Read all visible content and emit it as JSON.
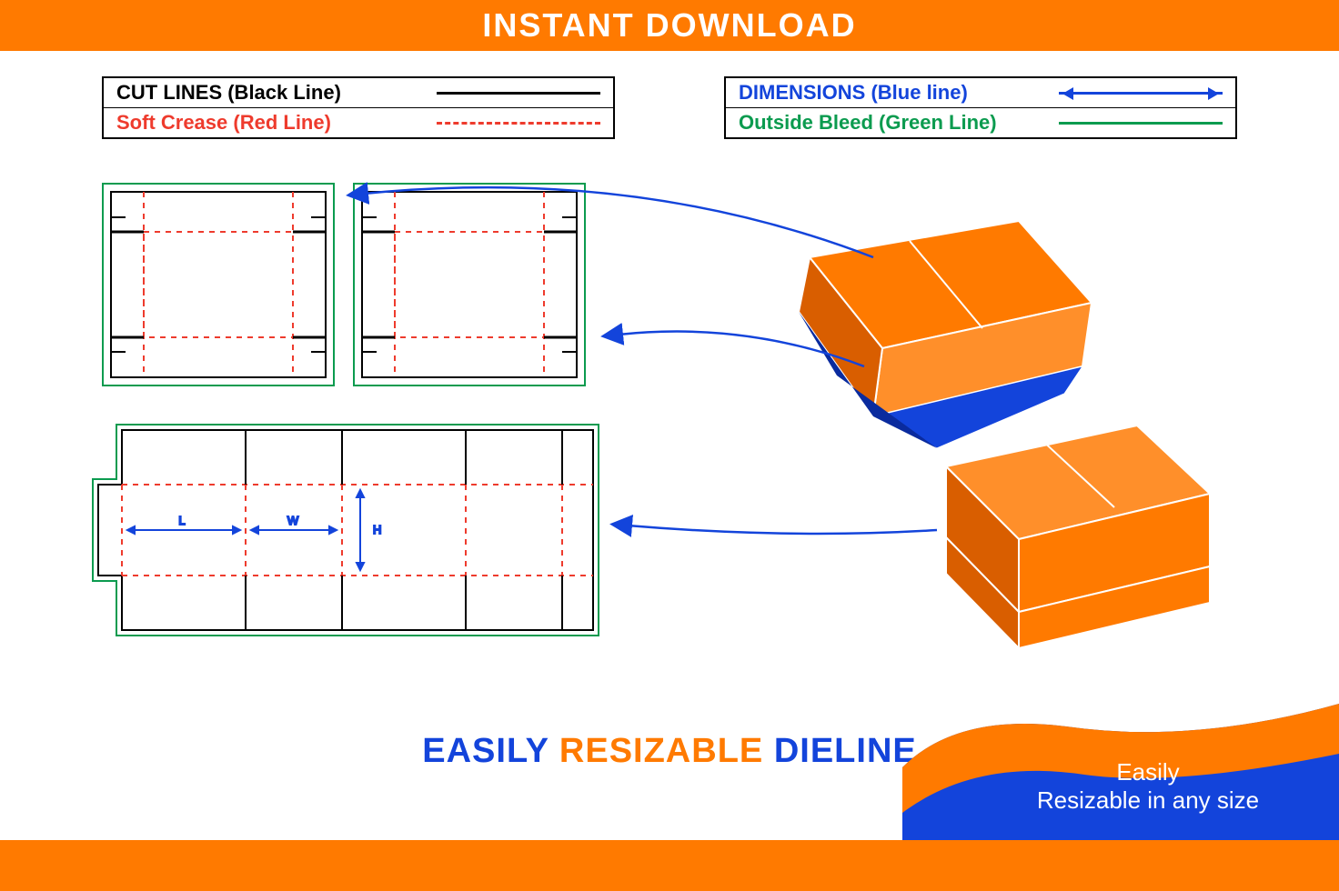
{
  "header": {
    "title": "INSTANT DOWNLOAD"
  },
  "legend": {
    "left": [
      {
        "label": "CUT LINES (Black Line)",
        "color": "#000000",
        "style": "solid"
      },
      {
        "label": "Soft Crease (Red Line)",
        "color": "#ee3b2d",
        "style": "dashed"
      }
    ],
    "right": [
      {
        "label": "DIMENSIONS (Blue line)",
        "color": "#1344db",
        "style": "arrow"
      },
      {
        "label": "Outside Bleed (Green Line)",
        "color": "#0b9b4f",
        "style": "solid"
      }
    ]
  },
  "dimensions": {
    "L": "L",
    "W": "W",
    "H": "H"
  },
  "footer": {
    "easily": "EASILY",
    "resizable": "RESIZABLE",
    "dieline": "DIELINE"
  },
  "badge": {
    "line1": "Easily",
    "line2": "Resizable in any size"
  },
  "colors": {
    "orange": "#ff7a00",
    "blue": "#1344db",
    "darkBlue": "#0a2b9e",
    "lightOrange": "#ff8f2a",
    "darkOrange": "#d95e00",
    "red": "#ee3b2d",
    "green": "#0b9b4f",
    "black": "#000000"
  }
}
